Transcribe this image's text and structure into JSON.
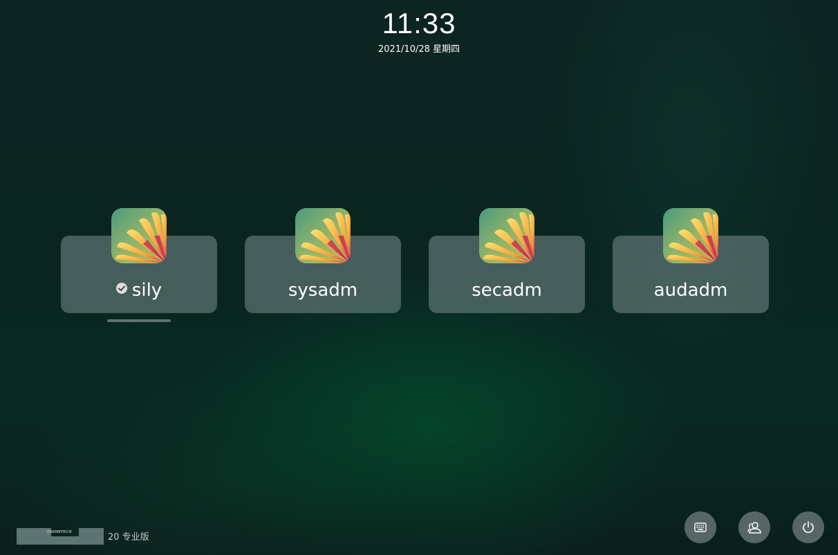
{
  "clock": {
    "time": "11:33",
    "date": "2021/10/28 星期四"
  },
  "users": [
    {
      "name": "sily",
      "selected": true
    },
    {
      "name": "sysadm",
      "selected": false
    },
    {
      "name": "secadm",
      "selected": false
    },
    {
      "name": "audadm",
      "selected": false
    }
  ],
  "brand": {
    "logo_text": "UNIONTECH",
    "edition": "20 专业版"
  },
  "bottom_buttons": [
    {
      "icon": "keyboard-icon"
    },
    {
      "icon": "switch-user-icon"
    },
    {
      "icon": "power-icon"
    }
  ],
  "colors": {
    "card_bg": "#788c8c",
    "text": "#ffffff"
  }
}
